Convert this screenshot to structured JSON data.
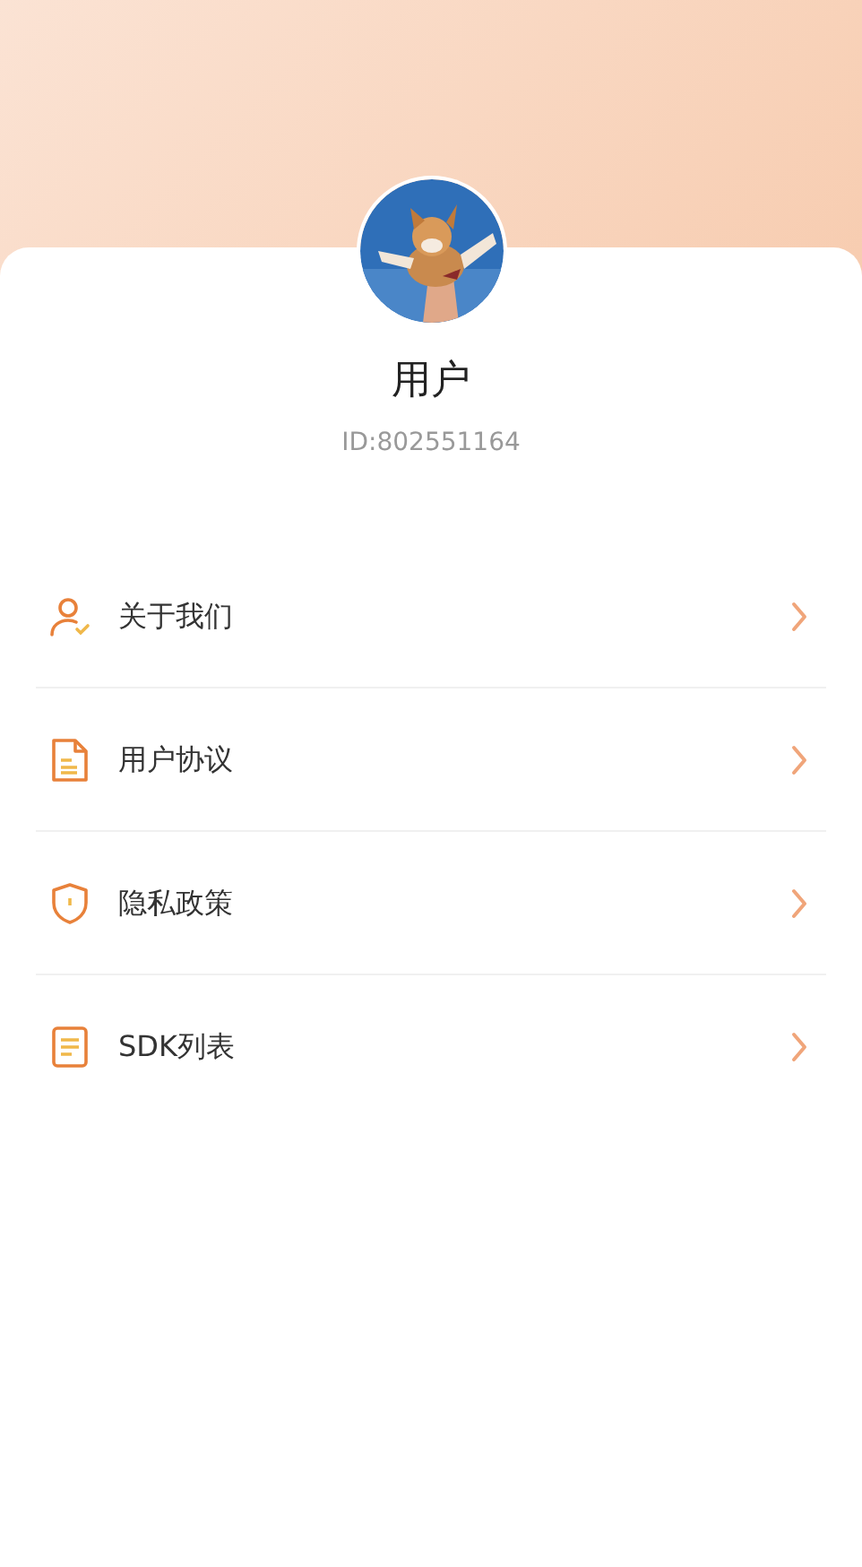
{
  "profile": {
    "name": "用户",
    "id": "ID:802551164"
  },
  "menu": [
    {
      "kind": "user",
      "label": "关于我们"
    },
    {
      "kind": "document",
      "label": "用户协议"
    },
    {
      "kind": "shield",
      "label": "隐私政策"
    },
    {
      "kind": "list",
      "label": "SDK列表"
    }
  ]
}
